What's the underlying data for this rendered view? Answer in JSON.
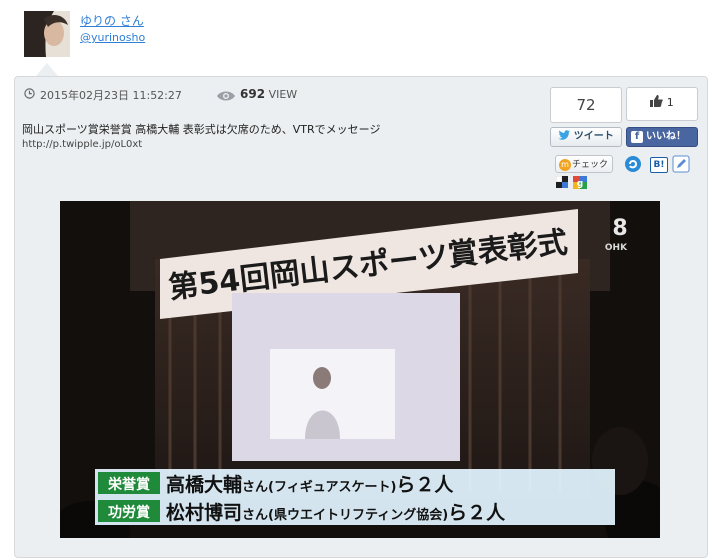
{
  "user": {
    "name": "ゆりの さん",
    "handle": "@yurinosho"
  },
  "post": {
    "timestamp": "2015年02月23日 11:52:27",
    "views_count": "692",
    "views_unit": "VIEW",
    "text": "岡山スポーツ賞栄誉賞 高橋大輔 表彰式は欠席のため、VTRでメッセージ",
    "link": "http://p.twipple.jp/oL0xt"
  },
  "share": {
    "count": "72",
    "like_count": "1",
    "tweet_label": "ツイート",
    "fb_label": "いいね！",
    "check_label": "チェック",
    "hatena_label": "B!"
  },
  "photo": {
    "banner": "第54回岡山スポーツ賞表彰式",
    "channel": "OHK",
    "channel_number": "8",
    "captions": [
      {
        "award": "栄誉賞",
        "name": "高橋大輔",
        "suffix": "さん",
        "detail": "(フィギュアスケート)",
        "count": "ら２人"
      },
      {
        "award": "功労賞",
        "name": "松村博司",
        "suffix": "さん",
        "detail": "(県ウエイトリフティング協会)",
        "count": "ら２人"
      }
    ]
  },
  "colors": {
    "link": "#2f7fd6",
    "facebook": "#4a66a0",
    "caption_green": "#1f8a3a",
    "caption_bg": "#dff0fb"
  },
  "icons": [
    "clock-icon",
    "eye-icon",
    "thumbs-up-icon",
    "twitter-bird-icon",
    "facebook-icon",
    "mixi-check-icon",
    "tumblr-icon",
    "hatena-bookmark-icon",
    "pencil-icon",
    "delicious-icon",
    "google-bookmark-icon"
  ]
}
